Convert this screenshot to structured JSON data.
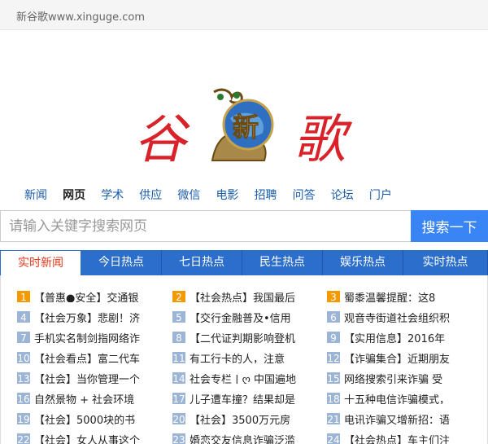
{
  "topbar": {
    "site": "新谷歌www.xinguge.com"
  },
  "logo": {
    "chars": [
      "谷",
      "新",
      "歌"
    ]
  },
  "nav": [
    "新闻",
    "网页",
    "学术",
    "供应",
    "微信",
    "电影",
    "招聘",
    "问答",
    "论坛",
    "门户"
  ],
  "search": {
    "placeholder": "请输入关键字搜索网页",
    "button": "搜索一下"
  },
  "tabs": [
    "实时新闻",
    "今日热点",
    "七日热点",
    "民生热点",
    "娱乐热点",
    "实时热点"
  ],
  "news": [
    {
      "n": "1",
      "t": "【普惠●安全】交通银"
    },
    {
      "n": "2",
      "t": "【社会热点】我国最后"
    },
    {
      "n": "3",
      "t": "蜀黍温馨提醒：这8"
    },
    {
      "n": "4",
      "t": "【社会万象】悲剧！济"
    },
    {
      "n": "5",
      "t": "【交行金融普及•信用"
    },
    {
      "n": "6",
      "t": "观音寺街道社会组织积"
    },
    {
      "n": "7",
      "t": "手机实名制剑指网络诈"
    },
    {
      "n": "8",
      "t": "【二代证判期影响登机"
    },
    {
      "n": "9",
      "t": "【实用信息】2016年"
    },
    {
      "n": "10",
      "t": "【社会看点】富二代车"
    },
    {
      "n": "11",
      "t": "有工行卡的人，注意"
    },
    {
      "n": "12",
      "t": "【诈骗集合】近期朋友"
    },
    {
      "n": "13",
      "t": "【社会】当你管理一个"
    },
    {
      "n": "14",
      "t": "社会专栏 | ღ 中国遍地"
    },
    {
      "n": "15",
      "t": "网络搜索引来诈骗 受"
    },
    {
      "n": "16",
      "t": "自然景物 + 社会环境"
    },
    {
      "n": "17",
      "t": "儿子遭车撞？结果却是"
    },
    {
      "n": "18",
      "t": "十五种电信诈骗模式，"
    },
    {
      "n": "19",
      "t": "【社会】5000块的书"
    },
    {
      "n": "20",
      "t": "【社会】3500万元房"
    },
    {
      "n": "21",
      "t": "电讯诈骗又增新招：语"
    },
    {
      "n": "22",
      "t": "【社会】女人从事这个"
    },
    {
      "n": "23",
      "t": "婚恋交友信息诈骗泛滥"
    },
    {
      "n": "24",
      "t": "【社会热点】车主们注"
    }
  ],
  "colors": {
    "hot": "#f29a00",
    "normal": "#9cb4d6",
    "tabbar": "#2c6ecb",
    "search_button": "#3a85f5",
    "logo_red": "#d9232a"
  }
}
